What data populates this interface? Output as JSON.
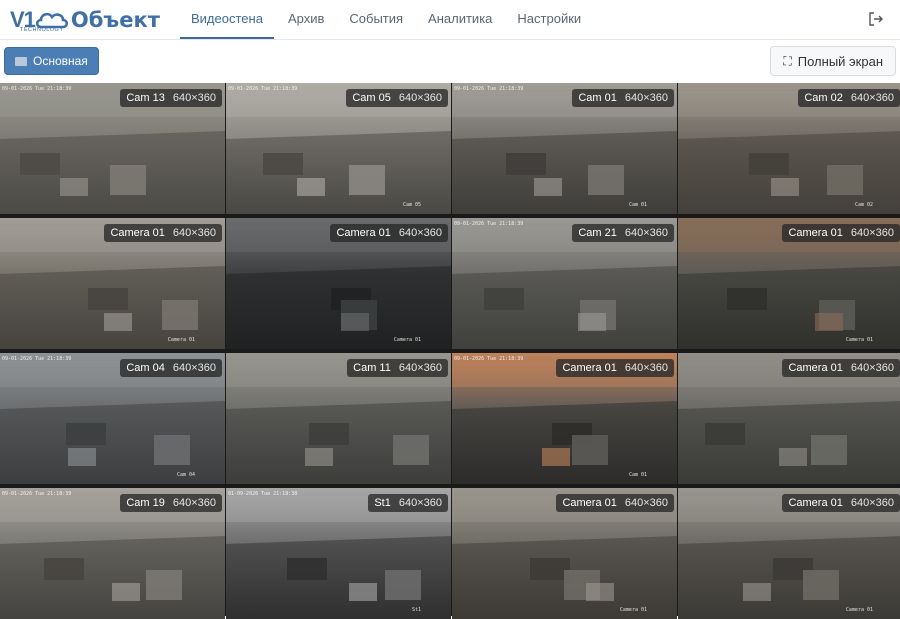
{
  "brand": {
    "logo_mark": "V1",
    "logo_tagline": "TECHNOLOGY",
    "title": "Объект"
  },
  "nav": [
    {
      "label": "Видеостена",
      "active": true
    },
    {
      "label": "Архив",
      "active": false
    },
    {
      "label": "События",
      "active": false
    },
    {
      "label": "Аналитика",
      "active": false
    },
    {
      "label": "Настройки",
      "active": false
    }
  ],
  "toolbar": {
    "layout_button": "Основная",
    "fullscreen_button": "Полный экран"
  },
  "icons": {
    "logout": "logout-icon",
    "layout": "monitor-icon",
    "fullscreen": "fullscreen-icon"
  },
  "colors": {
    "accent": "#3d6b96",
    "primary_button": "#4a7eb4"
  },
  "cameras": [
    {
      "name": "Cam 13",
      "resolution": "640×360",
      "stamp": "09-01-2026 Tue 21:18:39",
      "watermark": ""
    },
    {
      "name": "Cam 05",
      "resolution": "640×360",
      "stamp": "09-01-2026 Tue 21:18:39",
      "watermark": "Cam 05"
    },
    {
      "name": "Cam 01",
      "resolution": "640×360",
      "stamp": "09-01-2026 Tue 21:18:39",
      "watermark": "Cam 01"
    },
    {
      "name": "Cam 02",
      "resolution": "640×360",
      "stamp": "",
      "watermark": "Cam 02"
    },
    {
      "name": "Camera 01",
      "resolution": "640×360",
      "stamp": "",
      "watermark": "Camera 01"
    },
    {
      "name": "Camera 01",
      "resolution": "640×360",
      "stamp": "",
      "watermark": "Camera 01"
    },
    {
      "name": "Cam 21",
      "resolution": "640×360",
      "stamp": "09-01-2026 Tue 21:18:39",
      "watermark": ""
    },
    {
      "name": "Camera 01",
      "resolution": "640×360",
      "stamp": "",
      "watermark": "Camera 01"
    },
    {
      "name": "Cam 04",
      "resolution": "640×360",
      "stamp": "09-01-2026 Tue 21:18:39",
      "watermark": "Cam 04"
    },
    {
      "name": "Cam 11",
      "resolution": "640×360",
      "stamp": "",
      "watermark": ""
    },
    {
      "name": "Camera 01",
      "resolution": "640×360",
      "stamp": "09-01-2026 Tue 21:18:39",
      "watermark": "Cam 01"
    },
    {
      "name": "Camera 01",
      "resolution": "640×360",
      "stamp": "",
      "watermark": ""
    },
    {
      "name": "Cam 19",
      "resolution": "640×360",
      "stamp": "09-01-2026 Tue 21:18:39",
      "watermark": ""
    },
    {
      "name": "St1",
      "resolution": "640×360",
      "stamp": "01-09-2026 Tue 21:18:38",
      "watermark": "St1"
    },
    {
      "name": "Camera 01",
      "resolution": "640×360",
      "stamp": "",
      "watermark": "Camera 01"
    },
    {
      "name": "Camera 01",
      "resolution": "640×360",
      "stamp": "",
      "watermark": "Camera 01"
    }
  ]
}
